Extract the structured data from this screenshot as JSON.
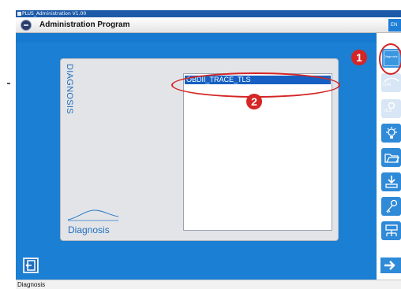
{
  "window": {
    "title": "PLUS_Administration V1.00"
  },
  "header": {
    "app_title": "Administration Program",
    "lang_label": "EN"
  },
  "panel": {
    "vertical_label": "DIAGNOSIS",
    "caption": "Diagnosis",
    "list": {
      "items": [
        {
          "label": "OBDII_TRACE_TLS",
          "selected": true
        }
      ]
    }
  },
  "side_toolbar": {
    "items": [
      {
        "label": "Diagnosis",
        "icon": "diagnosis-icon",
        "state": "active"
      },
      {
        "label": "DIA",
        "icon": "car-dia-icon",
        "state": "disabled"
      },
      {
        "label": "TES",
        "icon": "test-icon",
        "state": "disabled"
      },
      {
        "label": "",
        "icon": "lightbulb-icon",
        "state": "enabled"
      },
      {
        "label": "",
        "icon": "folder-icon",
        "state": "enabled"
      },
      {
        "label": "",
        "icon": "download-icon",
        "state": "enabled"
      },
      {
        "label": "",
        "icon": "key-icon",
        "state": "enabled"
      },
      {
        "label": "",
        "icon": "network-icon",
        "state": "enabled"
      }
    ]
  },
  "callouts": [
    {
      "number": "1"
    },
    {
      "number": "2"
    }
  ],
  "statusbar": {
    "text": "Diagnosis"
  },
  "colors": {
    "accent": "#1b7fd3",
    "callout": "#d52525",
    "selection": "#1560c2"
  }
}
